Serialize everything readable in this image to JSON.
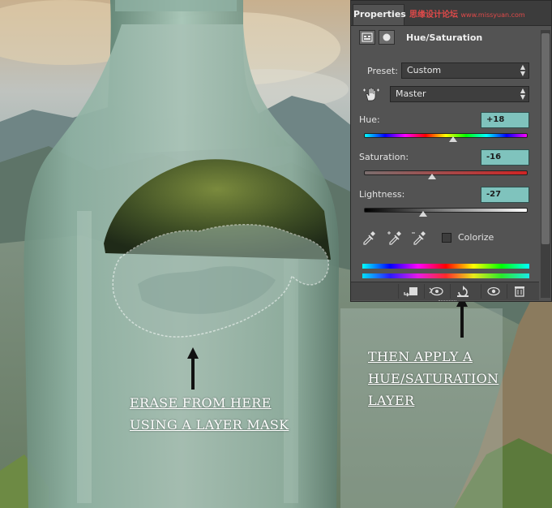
{
  "panel": {
    "tab_label": "Properties",
    "watermark": "思缘设计论坛",
    "watermark_site": "www.missyuan.com",
    "title": "Hue/Saturation",
    "preset_label": "Preset:",
    "preset_value": "Custom",
    "channel_value": "Master",
    "hue_label": "Hue:",
    "hue_value": "+18",
    "saturation_label": "Saturation:",
    "saturation_value": "-16",
    "lightness_label": "Lightness:",
    "lightness_value": "-27",
    "colorize_label": "Colorize",
    "colorize_checked": false,
    "hue_level": 18,
    "saturation_level": -16,
    "lightness_level": -27
  },
  "annotations": {
    "left_note_line1": "ERASE FROM HERE",
    "left_note_line2": "USING A LAYER MASK",
    "right_note_line1": "THEN APPLY A",
    "right_note_line2": "HUE/SATURATION",
    "right_note_line3": "LAYER"
  },
  "icons": [
    "adjustment-layer-icon",
    "mask-icon",
    "target-adjust-hand-icon",
    "eyedropper-icon",
    "eyedropper-plus-icon",
    "eyedropper-minus-icon",
    "clip-to-layer-icon",
    "view-previous-icon",
    "reset-icon",
    "visibility-eye-icon",
    "trash-icon",
    "arrow-up-icon"
  ]
}
